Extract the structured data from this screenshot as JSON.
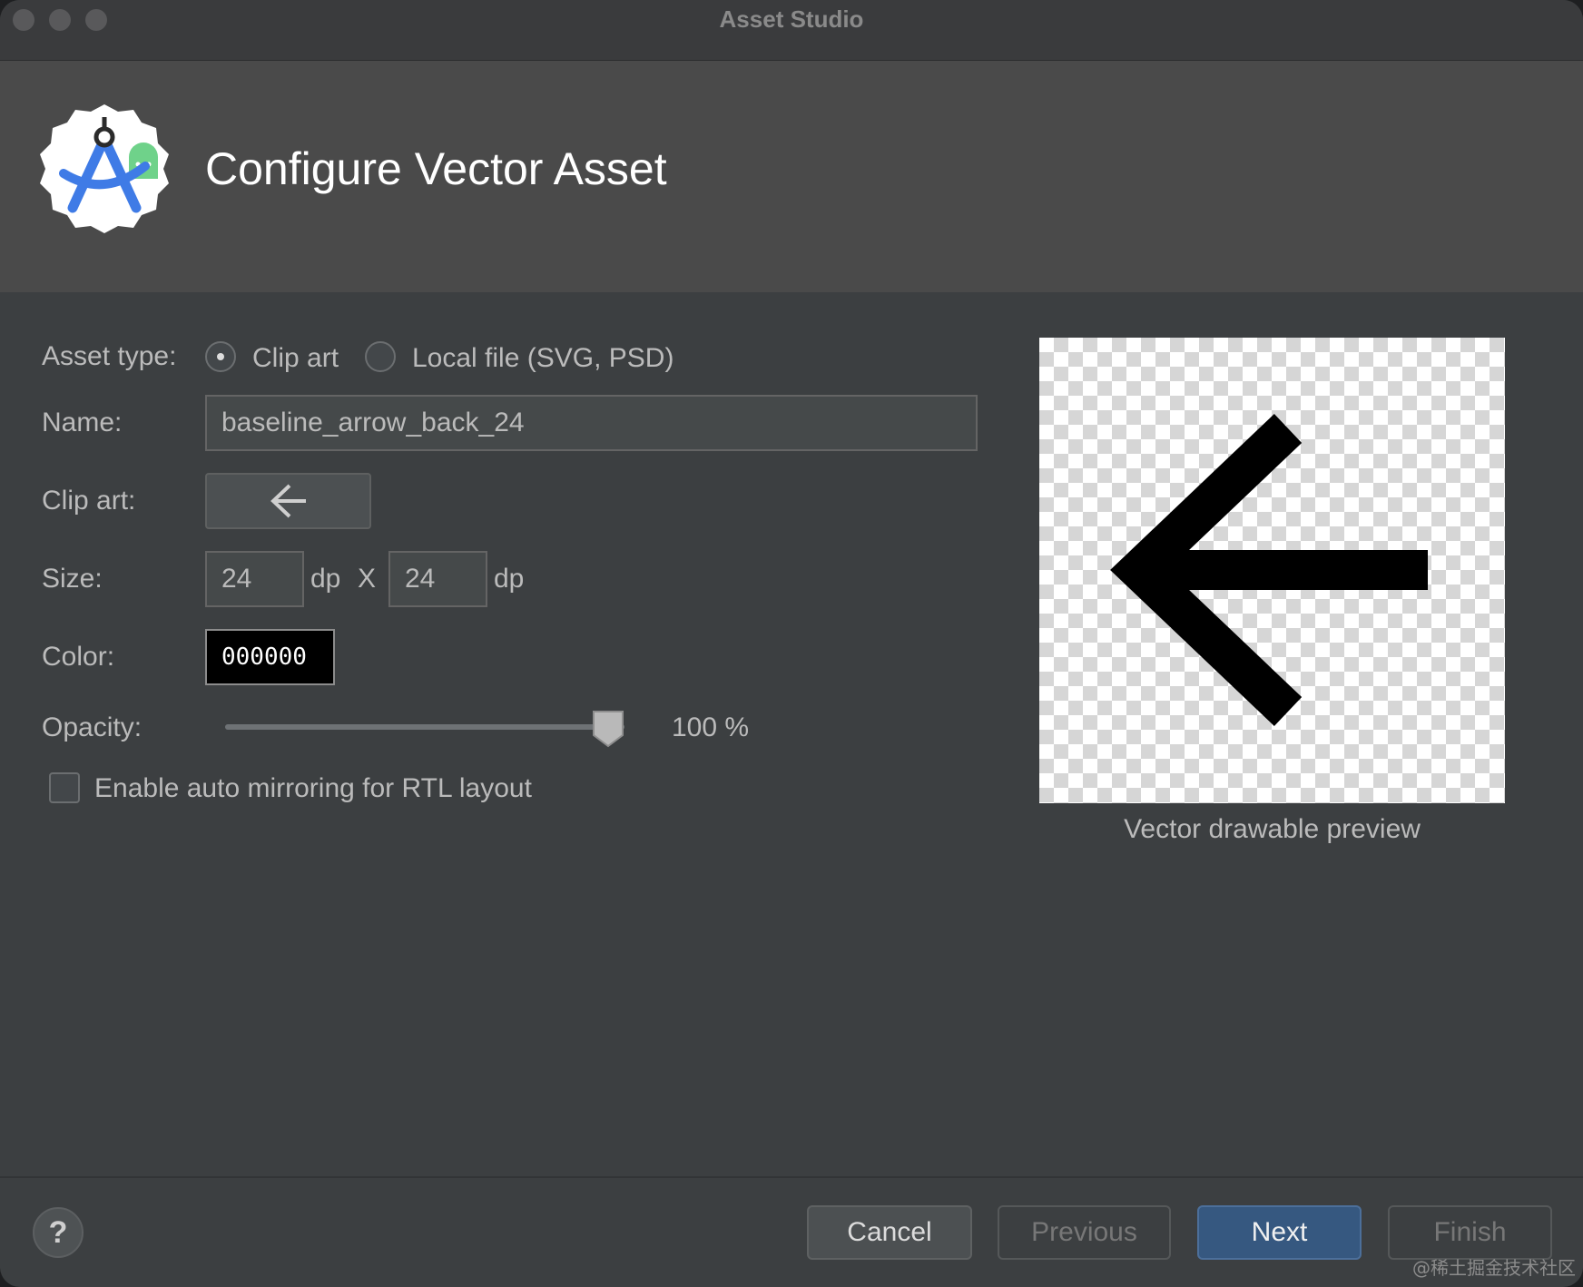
{
  "window": {
    "title": "Asset Studio"
  },
  "header": {
    "title": "Configure Vector Asset",
    "logo_icon": "android-studio-logo-icon"
  },
  "form": {
    "asset_type_label": "Asset type:",
    "asset_type_options": [
      {
        "label": "Clip art",
        "selected": true
      },
      {
        "label": "Local file (SVG, PSD)",
        "selected": false
      }
    ],
    "name_label": "Name:",
    "name_value": "baseline_arrow_back_24",
    "clip_art_label": "Clip art:",
    "clip_art_icon": "arrow-back-icon",
    "size_label": "Size:",
    "width_value": "24",
    "width_unit": "dp",
    "size_separator": "X",
    "height_value": "24",
    "height_unit": "dp",
    "color_label": "Color:",
    "color_value": "000000",
    "opacity_label": "Opacity:",
    "opacity_percent": 100,
    "opacity_text": "100 %",
    "auto_mirror_label": "Enable auto mirroring for RTL layout",
    "auto_mirror_checked": false
  },
  "preview": {
    "caption": "Vector drawable preview",
    "icon": "arrow-back-icon",
    "color": "#000000"
  },
  "footer": {
    "help": "?",
    "cancel": "Cancel",
    "previous": "Previous",
    "next": "Next",
    "finish": "Finish"
  },
  "colors": {
    "accent": "#365880",
    "window_bg": "#3c3f41",
    "header_bg": "#4a4a4a"
  },
  "watermark": "@稀土掘金技术社区"
}
